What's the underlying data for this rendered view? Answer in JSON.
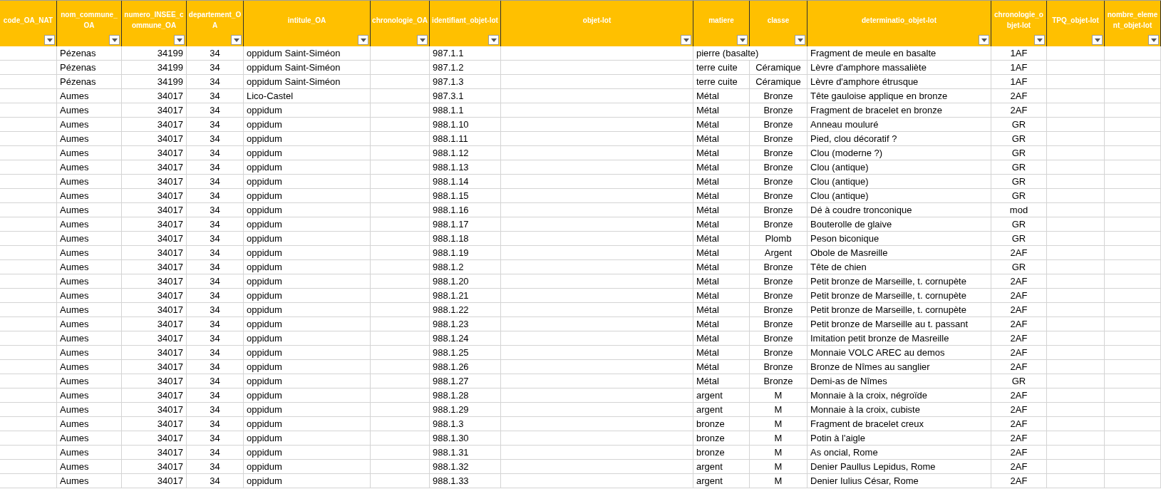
{
  "table": {
    "columns": [
      "code_OA_NAT",
      "nom_commune_OA",
      "numero_INSEE_commune_OA",
      "departement_OA",
      "intitule_OA",
      "chronologie_OA",
      "identifiant_objet-lot",
      "objet-lot",
      "matiere",
      "classe",
      "determinatio_objet-lot",
      "chronologie_objet-lot",
      "TPQ_objet-lot",
      "nombre_element_objet-lot"
    ],
    "rows": [
      [
        null,
        "Pézenas",
        "34199",
        "34",
        "oppidum Saint-Siméon",
        null,
        "987.1.1",
        null,
        "pierre (basalte)",
        null,
        "Fragment de meule en basalte",
        "1AF",
        null,
        null
      ],
      [
        null,
        "Pézenas",
        "34199",
        "34",
        "oppidum Saint-Siméon",
        null,
        "987.1.2",
        null,
        "terre cuite",
        "Céramique",
        "Lèvre d'amphore massaliète",
        "1AF",
        null,
        null
      ],
      [
        null,
        "Pézenas",
        "34199",
        "34",
        "oppidum Saint-Siméon",
        null,
        "987.1.3",
        null,
        "terre cuite",
        "Céramique",
        "Lèvre d'amphore étrusque",
        "1AF",
        null,
        null
      ],
      [
        null,
        "Aumes",
        "34017",
        "34",
        "Lico-Castel",
        null,
        "987.3.1",
        null,
        "Métal",
        "Bronze",
        "Tête gauloise applique en bronze",
        "2AF",
        null,
        null
      ],
      [
        null,
        "Aumes",
        "34017",
        "34",
        "oppidum",
        null,
        "988.1.1",
        null,
        "Métal",
        "Bronze",
        "Fragment de bracelet en bronze",
        "2AF",
        null,
        null
      ],
      [
        null,
        "Aumes",
        "34017",
        "34",
        "oppidum",
        null,
        "988.1.10",
        null,
        "Métal",
        "Bronze",
        "Anneau mouluré",
        "GR",
        null,
        null
      ],
      [
        null,
        "Aumes",
        "34017",
        "34",
        "oppidum",
        null,
        "988.1.11",
        null,
        "Métal",
        "Bronze",
        "Pied, clou décoratif ?",
        "GR",
        null,
        null
      ],
      [
        null,
        "Aumes",
        "34017",
        "34",
        "oppidum",
        null,
        "988.1.12",
        null,
        "Métal",
        "Bronze",
        "Clou (moderne ?)",
        "GR",
        null,
        null
      ],
      [
        null,
        "Aumes",
        "34017",
        "34",
        "oppidum",
        null,
        "988.1.13",
        null,
        "Métal",
        "Bronze",
        "Clou (antique)",
        "GR",
        null,
        null
      ],
      [
        null,
        "Aumes",
        "34017",
        "34",
        "oppidum",
        null,
        "988.1.14",
        null,
        "Métal",
        "Bronze",
        "Clou (antique)",
        "GR",
        null,
        null
      ],
      [
        null,
        "Aumes",
        "34017",
        "34",
        "oppidum",
        null,
        "988.1.15",
        null,
        "Métal",
        "Bronze",
        "Clou (antique)",
        "GR",
        null,
        null
      ],
      [
        null,
        "Aumes",
        "34017",
        "34",
        "oppidum",
        null,
        "988.1.16",
        null,
        "Métal",
        "Bronze",
        "Dé à coudre tronconique",
        "mod",
        null,
        null
      ],
      [
        null,
        "Aumes",
        "34017",
        "34",
        "oppidum",
        null,
        "988.1.17",
        null,
        "Métal",
        "Bronze",
        "Bouterolle de glaive",
        "GR",
        null,
        null
      ],
      [
        null,
        "Aumes",
        "34017",
        "34",
        "oppidum",
        null,
        "988.1.18",
        null,
        "Métal",
        "Plomb",
        "Peson biconique",
        "GR",
        null,
        null
      ],
      [
        null,
        "Aumes",
        "34017",
        "34",
        "oppidum",
        null,
        "988.1.19",
        null,
        "Métal",
        "Argent",
        "Obole de Masreille",
        "2AF",
        null,
        null
      ],
      [
        null,
        "Aumes",
        "34017",
        "34",
        "oppidum",
        null,
        "988.1.2",
        null,
        "Métal",
        "Bronze",
        "Tête de chien",
        "GR",
        null,
        null
      ],
      [
        null,
        "Aumes",
        "34017",
        "34",
        "oppidum",
        null,
        "988.1.20",
        null,
        "Métal",
        "Bronze",
        "Petit bronze de Marseille, t. cornupète",
        "2AF",
        null,
        null
      ],
      [
        null,
        "Aumes",
        "34017",
        "34",
        "oppidum",
        null,
        "988.1.21",
        null,
        "Métal",
        "Bronze",
        "Petit bronze de Marseille, t. cornupète",
        "2AF",
        null,
        null
      ],
      [
        null,
        "Aumes",
        "34017",
        "34",
        "oppidum",
        null,
        "988.1.22",
        null,
        "Métal",
        "Bronze",
        "Petit bronze de Marseille, t. cornupète",
        "2AF",
        null,
        null
      ],
      [
        null,
        "Aumes",
        "34017",
        "34",
        "oppidum",
        null,
        "988.1.23",
        null,
        "Métal",
        "Bronze",
        "Petit bronze de Marseille au t. passant",
        "2AF",
        null,
        null
      ],
      [
        null,
        "Aumes",
        "34017",
        "34",
        "oppidum",
        null,
        "988.1.24",
        null,
        "Métal",
        "Bronze",
        "Imitation petit bronze de Masreille",
        "2AF",
        null,
        null
      ],
      [
        null,
        "Aumes",
        "34017",
        "34",
        "oppidum",
        null,
        "988.1.25",
        null,
        "Métal",
        "Bronze",
        "Monnaie VOLC AREC au demos",
        "2AF",
        null,
        null
      ],
      [
        null,
        "Aumes",
        "34017",
        "34",
        "oppidum",
        null,
        "988.1.26",
        null,
        "Métal",
        "Bronze",
        "Bronze de Nîmes au sanglier",
        "2AF",
        null,
        null
      ],
      [
        null,
        "Aumes",
        "34017",
        "34",
        "oppidum",
        null,
        "988.1.27",
        null,
        "Métal",
        "Bronze",
        "Demi-as de Nîmes",
        "GR",
        null,
        null
      ],
      [
        null,
        "Aumes",
        "34017",
        "34",
        "oppidum",
        null,
        "988.1.28",
        null,
        "argent",
        "M",
        "Monnaie à la croix, négroïde",
        "2AF",
        null,
        null
      ],
      [
        null,
        "Aumes",
        "34017",
        "34",
        "oppidum",
        null,
        "988.1.29",
        null,
        "argent",
        "M",
        "Monnaie à la croix, cubiste",
        "2AF",
        null,
        null
      ],
      [
        null,
        "Aumes",
        "34017",
        "34",
        "oppidum",
        null,
        "988.1.3",
        null,
        "bronze",
        "M",
        "Fragment de bracelet creux",
        "2AF",
        null,
        null
      ],
      [
        null,
        "Aumes",
        "34017",
        "34",
        "oppidum",
        null,
        "988.1.30",
        null,
        "bronze",
        "M",
        "Potin à l'aigle",
        "2AF",
        null,
        null
      ],
      [
        null,
        "Aumes",
        "34017",
        "34",
        "oppidum",
        null,
        "988.1.31",
        null,
        "bronze",
        "M",
        "As oncial, Rome",
        "2AF",
        null,
        null
      ],
      [
        null,
        "Aumes",
        "34017",
        "34",
        "oppidum",
        null,
        "988.1.32",
        null,
        "argent",
        "M",
        "Denier Paullus Lepidus, Rome",
        "2AF",
        null,
        null
      ],
      [
        null,
        "Aumes",
        "34017",
        "34",
        "oppidum",
        null,
        "988.1.33",
        null,
        "argent",
        "M",
        "Denier Iulius César, Rome",
        "2AF",
        null,
        null
      ]
    ]
  }
}
